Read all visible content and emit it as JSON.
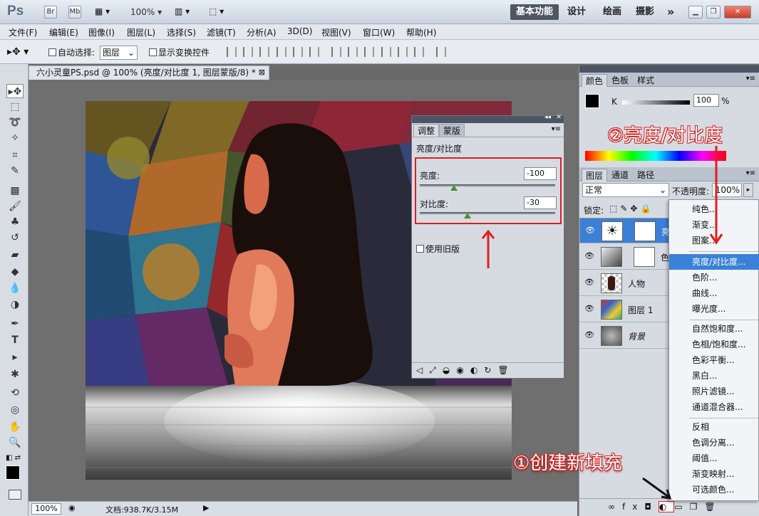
{
  "app": {
    "logo": "Ps",
    "bridge_btn": "Br",
    "minibridge_btn": "Mb",
    "zoom": "100%",
    "workspaces": [
      "基本功能",
      "设计",
      "绘画",
      "摄影"
    ],
    "more": "»"
  },
  "menubar": [
    "文件(F)",
    "编辑(E)",
    "图像(I)",
    "图层(L)",
    "选择(S)",
    "滤镜(T)",
    "分析(A)",
    "3D(D)",
    "视图(V)",
    "窗口(W)",
    "帮助(H)"
  ],
  "options": {
    "auto_select_label": "自动选择:",
    "auto_select_value": "图层",
    "show_transform_label": "显示变换控件"
  },
  "document": {
    "tab_title": "六小灵童PS.psd @ 100% (亮度/对比度 1, 图层蒙版/8) *",
    "status_zoom": "100%",
    "status_doc": "文档:938.7K/3.15M"
  },
  "adjustments": {
    "tabs": [
      "调整",
      "蒙版"
    ],
    "title": "亮度/对比度",
    "brightness_label": "亮度:",
    "brightness_value": "-100",
    "brightness_pos": 0.25,
    "contrast_label": "对比度:",
    "contrast_value": "-30",
    "contrast_pos": 0.35,
    "legacy_label": "使用旧版"
  },
  "color_panel": {
    "tabs": [
      "颜色",
      "色板",
      "样式"
    ],
    "channel": "K",
    "value": "100",
    "unit": "%"
  },
  "layers_panel": {
    "tabs": [
      "图层",
      "通道",
      "路径"
    ],
    "blend_mode": "正常",
    "opacity_label": "不透明度:",
    "opacity_value": "100%",
    "lock_label": "锁定:",
    "layers": [
      {
        "name": "亮",
        "selected": true
      },
      {
        "name": "色",
        "selected": false
      },
      {
        "name": "人物",
        "selected": false
      },
      {
        "name": "图层 1",
        "selected": false
      },
      {
        "name": "背景",
        "selected": false
      }
    ]
  },
  "adjustment_menu": {
    "groups": [
      [
        "纯色...",
        "渐变...",
        "图案..."
      ],
      [
        "亮度/对比度...",
        "色阶...",
        "曲线...",
        "曝光度..."
      ],
      [
        "自然饱和度...",
        "色相/饱和度...",
        "色彩平衡...",
        "黑白...",
        "照片滤镜...",
        "通道混合器..."
      ],
      [
        "反相",
        "色调分离...",
        "阈值...",
        "渐变映射...",
        "可选颜色..."
      ]
    ],
    "highlighted": "亮度/对比度..."
  },
  "annotations": {
    "step1": "①创建新填充",
    "step2": "②亮度/对比度"
  },
  "colors": {
    "highlight_red": "#e01e1e",
    "selection_blue": "#3a82d8"
  }
}
